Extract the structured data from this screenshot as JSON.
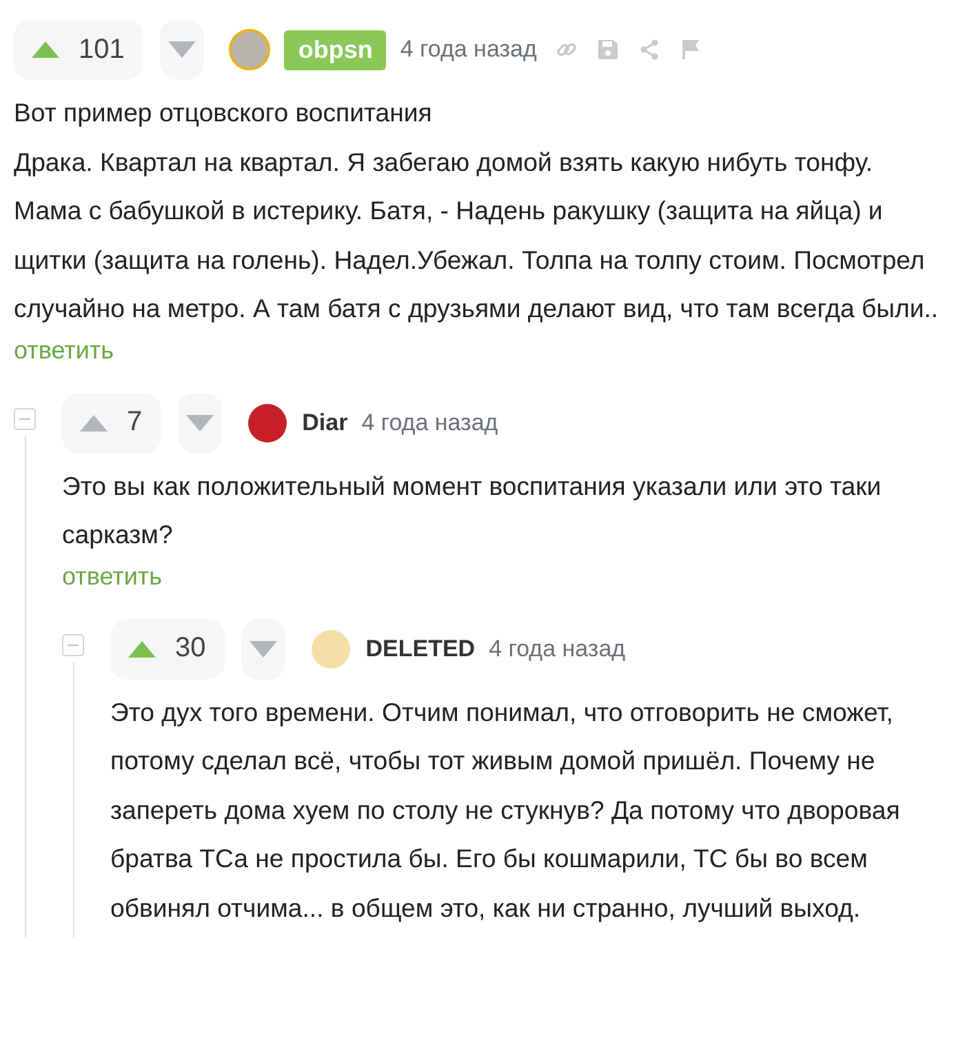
{
  "comments": [
    {
      "rating": "101",
      "voted_up": true,
      "author": "obpsn",
      "author_badge": true,
      "color": "#b9b4ad",
      "time": "4 года назад",
      "show_actions": true,
      "paragraphs": [
        "Вот пример отцовского воспитания",
        "Драка. Квартал на квартал. Я забегаю домой взять какую нибуть тонфу. Мама с бабушкой в истерику. Батя, - Надень ракушку (защита на яйца) и щитки (защита на голень). Надел.Убежал. Толпа на толпу стоим. Посмотрел случайно на метро. А там батя с друзьями делают вид, что там всегда были.."
      ],
      "reply_label": "ответить",
      "children": [
        {
          "rating": "7",
          "voted_up": false,
          "author": "Diar",
          "author_badge": false,
          "color": "#c8202a",
          "time": "4 года назад",
          "show_actions": false,
          "paragraphs": [
            "Это вы как положительный момент воспитания указали или это таки сарказм?"
          ],
          "reply_label": "ответить",
          "children": [
            {
              "rating": "30",
              "voted_up": true,
              "author": "DELETED",
              "author_badge": false,
              "color": "#f6dfa6",
              "time": "4 года назад",
              "show_actions": false,
              "paragraphs": [
                "Это дух того времени.  Отчим понимал, что отговорить не сможет, потому сделал всё, чтобы тот живым домой пришёл. Почему не запереть дома хуем по столу не стукнув? Да потому что дворовая братва ТСа не простила бы. Его бы кошмарили, ТС бы во всем обвинял отчима... в общем это, как ни странно, лучший выход."
              ]
            }
          ]
        }
      ]
    }
  ]
}
